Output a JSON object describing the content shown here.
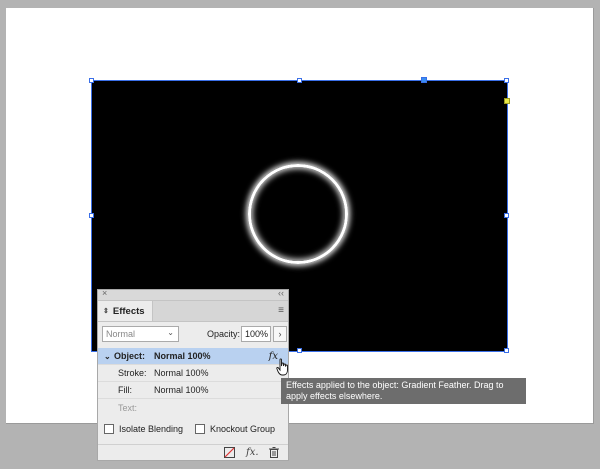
{
  "effects_panel": {
    "tab_label": "Effects",
    "close_glyph": "×",
    "collapse_glyph": "‹‹",
    "menu_glyph": "≡",
    "blend_mode": "Normal",
    "opacity_label": "Opacity:",
    "opacity_value": "100%",
    "opacity_arrow": "›",
    "rows": [
      {
        "label": "Object:",
        "value": "Normal 100%",
        "fx": "fx"
      },
      {
        "label": "Stroke:",
        "value": "Normal 100%"
      },
      {
        "label": "Fill:",
        "value": "Normal 100%"
      },
      {
        "label": "Text:",
        "value": ""
      }
    ],
    "isolate_blending": "Isolate Blending",
    "knockout_group": "Knockout Group",
    "fx_button": "fx.",
    "icons": [
      "clear-effects-icon",
      "fx-menu-icon",
      "trash-icon"
    ]
  },
  "tooltip": {
    "text": "Effects applied to the object: Gradient Feather. Drag to apply effects elsewhere."
  },
  "colors": {
    "selection": "#3a6fe8",
    "panel_bg": "#ececec",
    "object_row_highlight": "#b9d1f0",
    "tooltip_bg": "#6d6d6d"
  }
}
